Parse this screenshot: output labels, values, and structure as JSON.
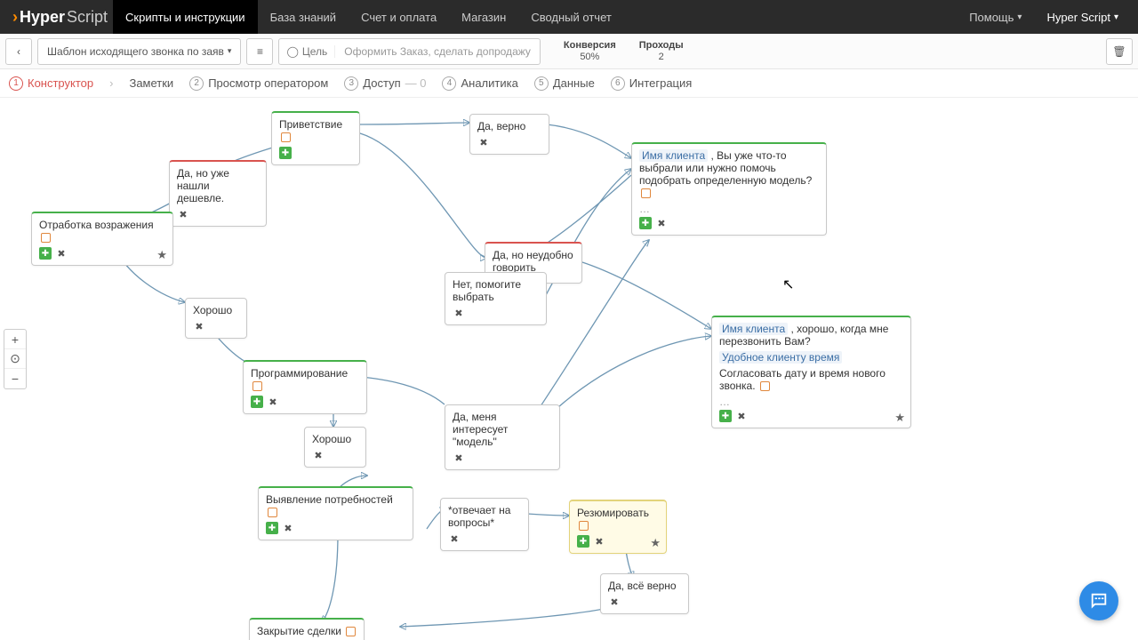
{
  "brand": {
    "pre": "Hyper",
    "post": "Script"
  },
  "nav": {
    "items": [
      {
        "label": "Скрипты и инструкции",
        "active": true
      },
      {
        "label": "База знаний"
      },
      {
        "label": "Счет и оплата"
      },
      {
        "label": "Магазин"
      },
      {
        "label": "Сводный отчет"
      }
    ],
    "help": "Помощь",
    "user": "Hyper Script"
  },
  "toolbar": {
    "back": "‹",
    "template": "Шаблон исходящего звонка по заяв",
    "goal_label": "Цель",
    "goal_text": "Оформить Заказ, сделать допродажу",
    "metrics": [
      {
        "label": "Конверсия",
        "value": "50%"
      },
      {
        "label": "Проходы",
        "value": "2"
      }
    ]
  },
  "subtabs": {
    "items": [
      {
        "n": "1",
        "label": "Конструктор",
        "active": true
      },
      {
        "label": "Заметки",
        "plain": true
      },
      {
        "n": "2",
        "label": "Просмотр оператором"
      },
      {
        "n": "3",
        "label": "Доступ",
        "suffix": "— 0"
      },
      {
        "n": "4",
        "label": "Аналитика"
      },
      {
        "n": "5",
        "label": "Данные"
      },
      {
        "n": "6",
        "label": "Интеграция"
      }
    ]
  },
  "nodes": {
    "greet": {
      "label": "Приветствие"
    },
    "yes_true": {
      "label": "Да, верно"
    },
    "cheaper": {
      "label": "Да, но уже нашли\nдешевле."
    },
    "objection": {
      "label": "Отработка возражения"
    },
    "ok1": {
      "label": "Хорошо"
    },
    "busy": {
      "label": "Да, но неудобно\nговорить"
    },
    "help_pick": {
      "label": "Нет, помогите\nвыбрать"
    },
    "client_q": {
      "var": "Имя клиента",
      "tail": " , Вы уже что-то выбрали или нужно помочь подобрать определенную модель?"
    },
    "callback": {
      "var": "Имя клиента",
      "line1": " , хорошо, когда мне перезвонить Вам?",
      "var2": "Удобное клиенту время",
      "red": "Согласовать дату и время нового звонка."
    },
    "prog": {
      "label": "Программирование"
    },
    "ok2": {
      "label": "Хорошо"
    },
    "model": {
      "label": "Да, меня интересует\n\"модель\""
    },
    "needs": {
      "label": "Выявление потребностей"
    },
    "answers": {
      "label": "*отвечает на\nвопросы*"
    },
    "resume": {
      "label": "Резюмировать"
    },
    "all_ok": {
      "label": "Да, всё верно"
    },
    "close": {
      "label": "Закрытие сделки"
    }
  },
  "zoom": {
    "plus": "+",
    "dot": "⊙",
    "minus": "−"
  }
}
